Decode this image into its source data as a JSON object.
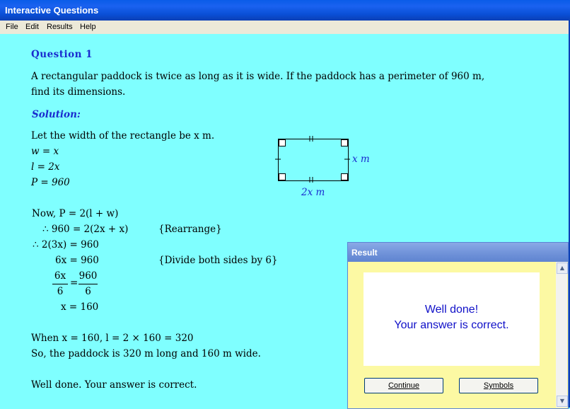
{
  "window": {
    "title": "Interactive Questions"
  },
  "menu": [
    "File",
    "Edit",
    "Results",
    "Help"
  ],
  "question": {
    "heading": "Question 1",
    "text_line1": "A rectangular paddock is twice as long as it is wide.  If the paddock has a perimeter of 960 m,",
    "text_line2": "find its dimensions."
  },
  "solution": {
    "heading": "Solution:",
    "lines": [
      "Let the width of the rectangle be x m.",
      "w = x",
      "l = 2x",
      "P = 960"
    ],
    "diagram": {
      "side_label": "x m",
      "bottom_label": "2x m"
    },
    "work": {
      "now": "Now, P = 2(l + w)",
      "step1": "∴ 960 = 2(2x + x)",
      "step1_note": "{Rearrange}",
      "step2": "∴ 2(3x) = 960",
      "step3": "6x = 960",
      "step3_note": "{Divide both sides by 6}",
      "frac_left_num": "6x",
      "frac_left_den": "6",
      "equals": "=",
      "frac_right_num": "960",
      "frac_right_den": "6",
      "step5": "x = 160"
    },
    "when": "When x = 160, l = 2 × 160 = 320",
    "so": "So, the paddock is 320 m long and 160 m wide.",
    "feedback": "Well done.  Your answer is correct."
  },
  "dialog": {
    "title": "Result",
    "message_line1": "Well done!",
    "message_line2": "Your answer is correct.",
    "continue_label": "Continue",
    "symbols_label": "Symbols"
  }
}
